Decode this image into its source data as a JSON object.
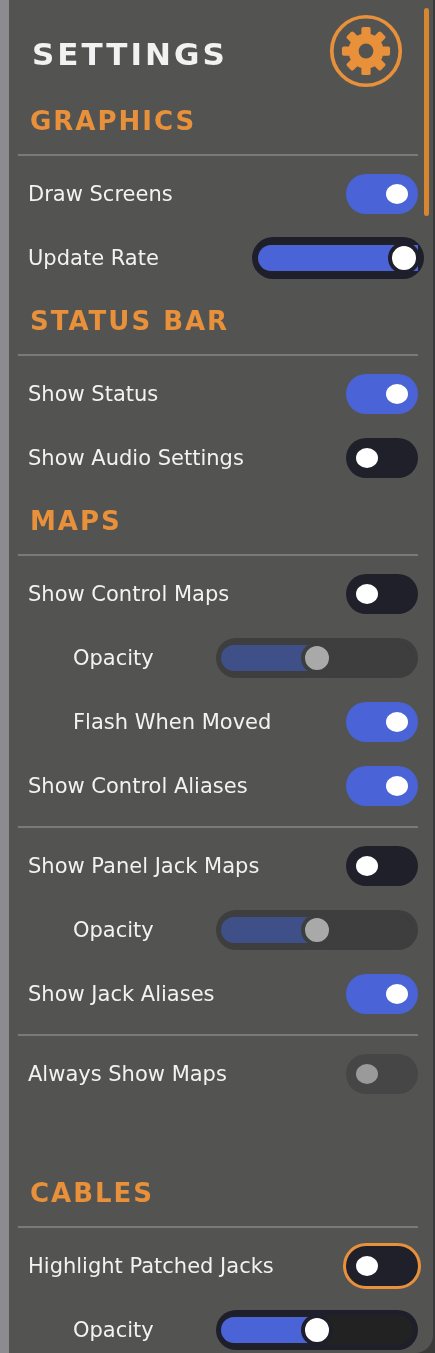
{
  "title": "SETTINGS",
  "sections": [
    {
      "heading": "GRAPHICS",
      "groups": [
        [
          {
            "kind": "toggle",
            "label": "Draw Screens",
            "on": true,
            "disabled": false,
            "focused": false
          },
          {
            "kind": "slider",
            "label": "Update Rate",
            "level": 1,
            "disabled": false
          }
        ]
      ]
    },
    {
      "heading": "STATUS BAR",
      "groups": [
        [
          {
            "kind": "toggle",
            "label": "Show Status",
            "on": true,
            "disabled": false,
            "focused": false
          },
          {
            "kind": "toggle",
            "label": "Show Audio Settings",
            "on": false,
            "disabled": false,
            "focused": false
          }
        ]
      ]
    },
    {
      "heading": "MAPS",
      "groups": [
        [
          {
            "kind": "toggle",
            "label": "Show Control Maps",
            "on": false,
            "disabled": false,
            "focused": false,
            "children": [
              {
                "kind": "slider",
                "label": "Opacity",
                "level": 0.5,
                "disabled": true
              },
              {
                "kind": "toggle",
                "label": "Flash When Moved",
                "on": true,
                "disabled": false,
                "focused": false
              }
            ]
          },
          {
            "kind": "toggle",
            "label": "Show Control Aliases",
            "on": true,
            "disabled": false,
            "focused": false
          }
        ],
        [
          {
            "kind": "toggle",
            "label": "Show Panel Jack Maps",
            "on": false,
            "disabled": false,
            "focused": false,
            "children": [
              {
                "kind": "slider",
                "label": "Opacity",
                "level": 0.5,
                "disabled": true
              }
            ]
          },
          {
            "kind": "toggle",
            "label": "Show Jack Aliases",
            "on": true,
            "disabled": false,
            "focused": false
          }
        ],
        [
          {
            "kind": "toggle",
            "label": "Always Show Maps",
            "on": false,
            "disabled": true,
            "focused": false
          }
        ]
      ]
    },
    {
      "heading": "CABLES",
      "groups": [
        [
          {
            "kind": "toggle",
            "label": "Highlight Patched Jacks",
            "on": false,
            "disabled": false,
            "focused": true,
            "children": [
              {
                "kind": "slider",
                "label": "Opacity",
                "level": 0.5,
                "disabled": false
              }
            ]
          }
        ]
      ]
    }
  ]
}
